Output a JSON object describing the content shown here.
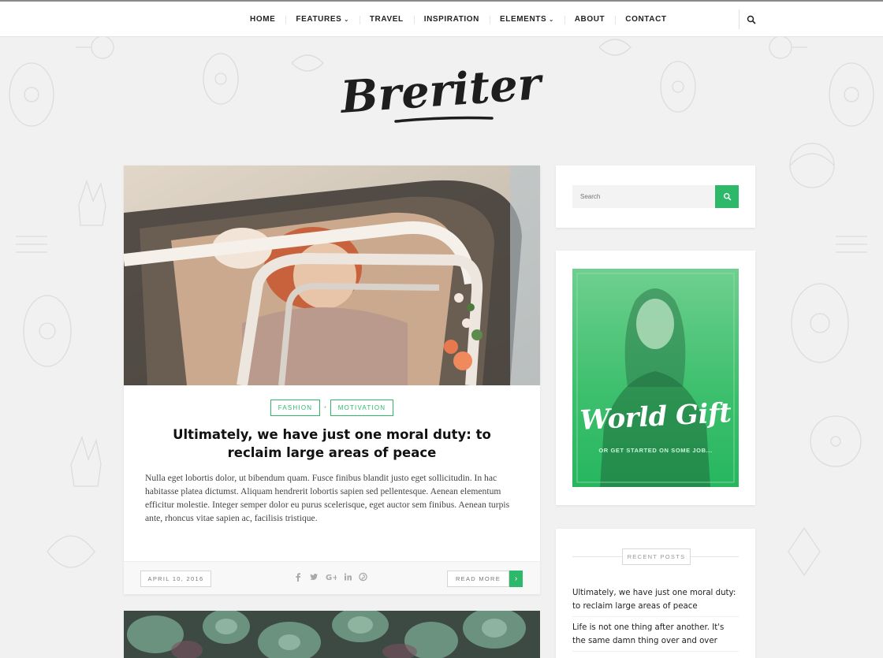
{
  "nav": {
    "items": [
      {
        "label": "HOME",
        "has_dropdown": false
      },
      {
        "label": "FEATURES",
        "has_dropdown": true
      },
      {
        "label": "TRAVEL",
        "has_dropdown": false
      },
      {
        "label": "INSPIRATION",
        "has_dropdown": false
      },
      {
        "label": "ELEMENTS",
        "has_dropdown": true
      },
      {
        "label": "ABOUT",
        "has_dropdown": false
      },
      {
        "label": "CONTACT",
        "has_dropdown": false
      }
    ],
    "dropdown_icon": "⌄",
    "search_icon": "search-icon"
  },
  "logo": {
    "text": "Breriter"
  },
  "post": {
    "tags": [
      "FASHION",
      "MOTIVATION"
    ],
    "tag_separator": "•",
    "title": "Ultimately, we have just one moral duty: to reclaim large areas of peace",
    "excerpt": "Nulla eget lobortis dolor, ut bibendum quam. Fusce finibus blandit justo eget sollicitudin. In hac habitasse platea dictumst. Aliquam hendrerit lobortis sapien sed pellentesque. Aenean elementum efficitur molestie. Integer semper dolor eu purus scelerisque, eget auctor sem finibus. Aenean turpis ante, rhoncus vitae sapien ac, facilisis tristique.",
    "date": "APRIL 10, 2016",
    "read_more": "READ MORE",
    "read_more_arrow": "›",
    "share_icons": [
      "facebook-icon",
      "twitter-icon",
      "google-plus-icon",
      "linkedin-icon",
      "pinterest-icon"
    ]
  },
  "sidebar": {
    "search_placeholder": "Search",
    "ad": {
      "title": "World Gift",
      "subtitle": "OR GET STARTED ON SOME JOB..."
    },
    "recent_heading": "RECENT POSTS",
    "recent_posts": [
      "Ultimately, we have just one moral duty: to reclaim large areas of peace",
      "Life is not one thing after another. It's the same damn thing over and over"
    ]
  },
  "colors": {
    "accent": "#2db86a",
    "background": "#f1f1f1",
    "text": "#222222"
  }
}
